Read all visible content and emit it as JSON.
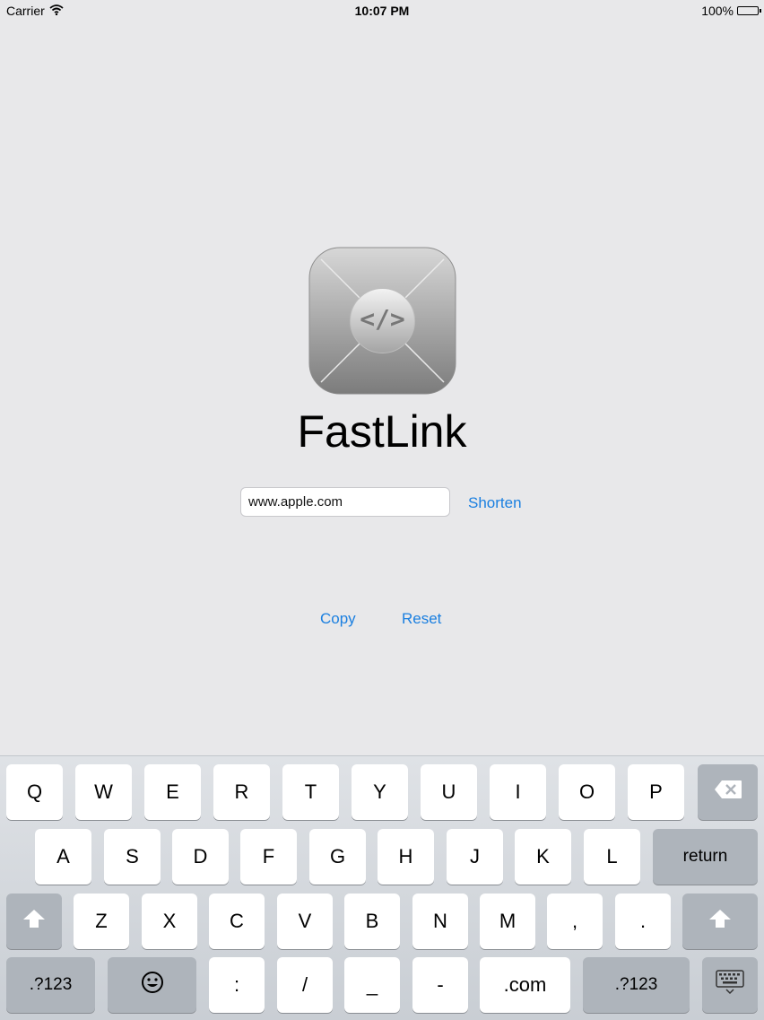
{
  "status_bar": {
    "carrier": "Carrier",
    "time": "10:07 PM",
    "battery": "100%"
  },
  "app": {
    "icon_glyph": "</>",
    "title": "FastLink"
  },
  "url_input": {
    "value": "www.apple.com"
  },
  "buttons": {
    "shorten": "Shorten",
    "copy": "Copy",
    "reset": "Reset"
  },
  "keyboard": {
    "row1": [
      "Q",
      "W",
      "E",
      "R",
      "T",
      "Y",
      "U",
      "I",
      "O",
      "P"
    ],
    "row2": [
      "A",
      "S",
      "D",
      "F",
      "G",
      "H",
      "J",
      "K",
      "L"
    ],
    "return": "return",
    "row3": [
      "Z",
      "X",
      "C",
      "V",
      "B",
      "N",
      "M",
      ",",
      "."
    ],
    "row4": {
      "numbers_left": ".?123",
      "colon": ":",
      "slash": "/",
      "underscore": "_",
      "dash": "-",
      "dotcom": ".com",
      "numbers_right": ".?123"
    }
  },
  "colors": {
    "accent": "#1a7fe0",
    "background": "#e8e8ea",
    "key_dark": "#aeb4bb"
  }
}
